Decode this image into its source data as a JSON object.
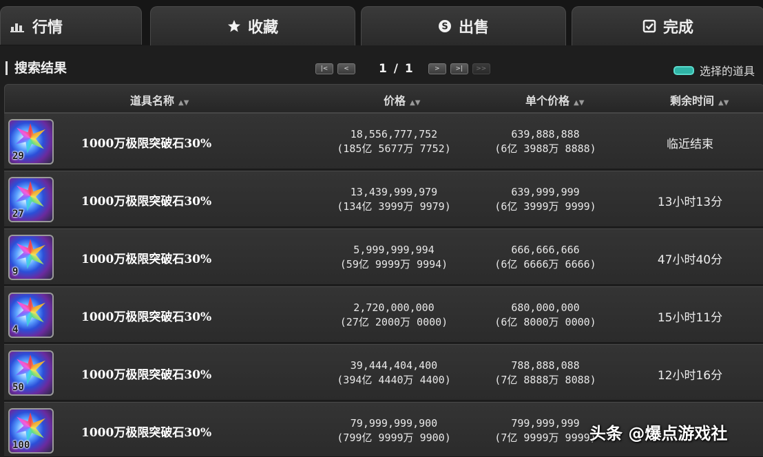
{
  "tabs": [
    {
      "label": "行情",
      "icon": "market-icon"
    },
    {
      "label": "收藏",
      "icon": "star-icon"
    },
    {
      "label": "出售",
      "icon": "sell-coin-icon"
    },
    {
      "label": "完成",
      "icon": "checkbox-icon"
    }
  ],
  "section_title": "搜索结果",
  "pager": {
    "first": "|<",
    "prev": "<",
    "next": ">",
    "last": ">|",
    "extra": ">>",
    "current": "1",
    "separator": "/",
    "total": "1"
  },
  "legend_label": "选择的道具",
  "legend_color": "#2fb4a6",
  "columns": {
    "name": "道具名称",
    "price": "价格",
    "unit_price": "单个价格",
    "time_left": "剩余时间"
  },
  "rows": [
    {
      "qty": "29",
      "name": "1000万极限突破石30%",
      "price": "18,556,777,752",
      "price_cn": "(185亿 5677万 7752)",
      "unit": "639,888,888",
      "unit_cn": "(6亿 3988万 8888)",
      "time": "临近结束"
    },
    {
      "qty": "27",
      "name": "1000万极限突破石30%",
      "price": "13,439,999,979",
      "price_cn": "(134亿 3999万 9979)",
      "unit": "639,999,999",
      "unit_cn": "(6亿 3999万 9999)",
      "time": "13小时13分"
    },
    {
      "qty": "9",
      "name": "1000万极限突破石30%",
      "price": "5,999,999,994",
      "price_cn": "(59亿 9999万 9994)",
      "unit": "666,666,666",
      "unit_cn": "(6亿 6666万 6666)",
      "time": "47小时40分"
    },
    {
      "qty": "4",
      "name": "1000万极限突破石30%",
      "price": "2,720,000,000",
      "price_cn": "(27亿 2000万 0000)",
      "unit": "680,000,000",
      "unit_cn": "(6亿 8000万 0000)",
      "time": "15小时11分"
    },
    {
      "qty": "50",
      "name": "1000万极限突破石30%",
      "price": "39,444,404,400",
      "price_cn": "(394亿 4440万 4400)",
      "unit": "788,888,088",
      "unit_cn": "(7亿 8888万 8088)",
      "time": "12小时16分"
    },
    {
      "qty": "100",
      "name": "1000万极限突破石30%",
      "price": "79,999,999,900",
      "price_cn": "(799亿 9999万 9900)",
      "unit": "799,999,999",
      "unit_cn": "(7亿 9999万 9999)",
      "time": ""
    }
  ],
  "watermark": "头条 @爆点游戏社"
}
